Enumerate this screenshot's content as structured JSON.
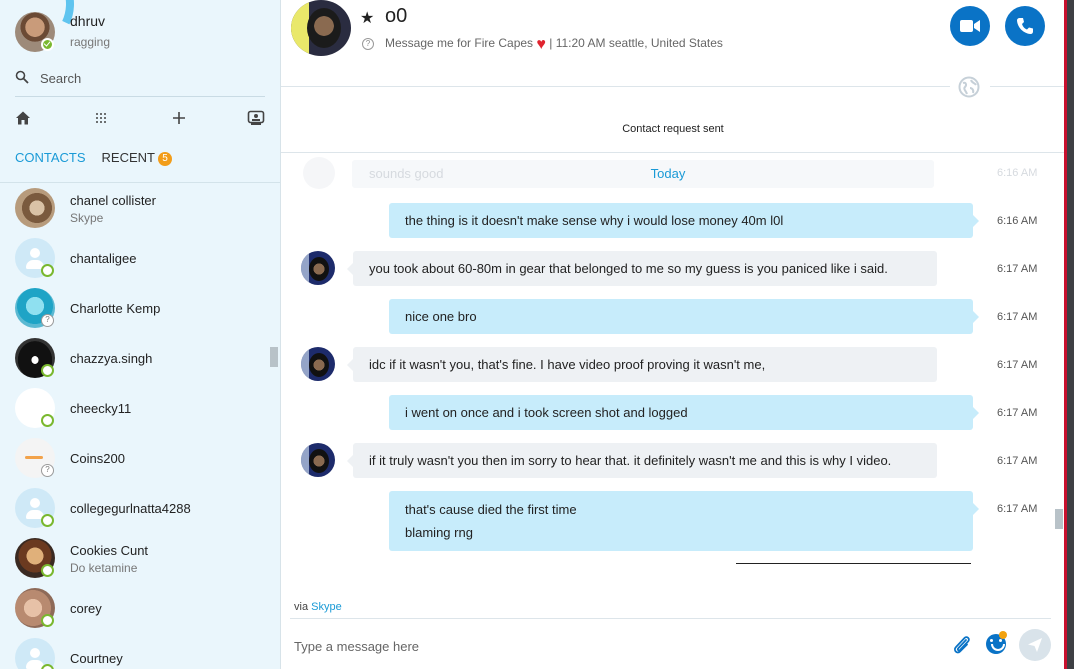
{
  "profile": {
    "name": "dhruv",
    "mood": "ragging"
  },
  "search": {
    "placeholder": "Search"
  },
  "tabs": {
    "contacts": "CONTACTS",
    "recent": "RECENT",
    "recent_badge": "5"
  },
  "contacts": [
    {
      "name": "chanel collister",
      "sub": "Skype",
      "status": "none"
    },
    {
      "name": "chantaligee",
      "sub": "",
      "status": "ring"
    },
    {
      "name": "Charlotte Kemp",
      "sub": "",
      "status": "unknown"
    },
    {
      "name": "chazzya.singh",
      "sub": "",
      "status": "ring"
    },
    {
      "name": "cheecky11",
      "sub": "",
      "status": "ring"
    },
    {
      "name": "Coins200",
      "sub": "",
      "status": "unknown"
    },
    {
      "name": "collegegurlnatta4288",
      "sub": "",
      "status": "ring"
    },
    {
      "name": "Cookies Cunt",
      "sub": "Do ketamine",
      "status": "ring"
    },
    {
      "name": "corey",
      "sub": "",
      "status": "ring"
    },
    {
      "name": "Courtney",
      "sub": "",
      "status": "ring"
    }
  ],
  "chat": {
    "title": "o0",
    "mood": "Message me for Fire Capes",
    "location": "|  11:20 AM seattle, United States",
    "contact_request": "Contact request sent",
    "ghost_text": "sounds good",
    "ghost_time": "6:16 AM",
    "today": "Today"
  },
  "messages": [
    {
      "dir": "out",
      "lines": [
        "the thing is it doesn't make sense why i would lose money 40m l0l"
      ],
      "time": "6:16 AM"
    },
    {
      "dir": "in",
      "lines": [
        "you took about 60-80m in gear that belonged to me so my guess is you paniced like i said."
      ],
      "time": "6:17 AM"
    },
    {
      "dir": "out",
      "lines": [
        "nice one bro"
      ],
      "time": "6:17 AM"
    },
    {
      "dir": "in",
      "lines": [
        "idc if it wasn't you, that's fine. I have video proof proving it wasn't me,"
      ],
      "time": "6:17 AM"
    },
    {
      "dir": "out",
      "lines": [
        "i went on once and i took screen shot and logged"
      ],
      "time": "6:17 AM"
    },
    {
      "dir": "in",
      "lines": [
        "if it truly wasn't you then im sorry to hear that. it definitely wasn't me and this is why I video."
      ],
      "time": "6:17 AM"
    },
    {
      "dir": "out",
      "lines": [
        "that's cause died the first time",
        "blaming rng"
      ],
      "time": "6:17 AM"
    }
  ],
  "composer": {
    "via_prefix": "via",
    "via_link": "Skype",
    "placeholder": "Type a message here"
  },
  "colors": {
    "accent": "#1a9ad6",
    "call_button": "#0a73c6",
    "outgoing_bubble": "#c7ecfb",
    "incoming_bubble": "#eef1f4",
    "online": "#7ab82f",
    "badge": "#f29d1a"
  }
}
